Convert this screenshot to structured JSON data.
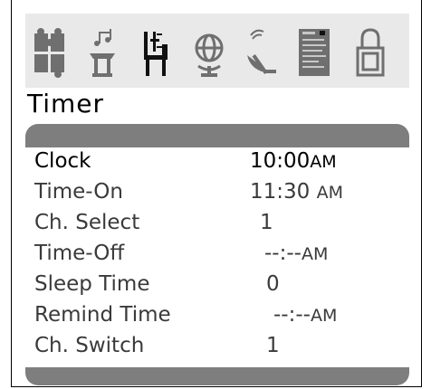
{
  "menu_icons": [
    {
      "name": "puzzle-icon"
    },
    {
      "name": "music-stage-icon"
    },
    {
      "name": "settings-chair-icon"
    },
    {
      "name": "globe-icon"
    },
    {
      "name": "satellite-dish-icon"
    },
    {
      "name": "document-page-icon"
    },
    {
      "name": "lock-icon"
    }
  ],
  "page": {
    "title": "Timer"
  },
  "rows": [
    {
      "label": "Clock",
      "value": "10:00",
      "ampm": "AM"
    },
    {
      "label": "Time-On",
      "value": "11:30",
      "ampm": "AM"
    },
    {
      "label": "Ch. Select",
      "value": "1",
      "ampm": ""
    },
    {
      "label": "Time-Off",
      "value": "--:--",
      "ampm": "AM"
    },
    {
      "label": "Sleep Time",
      "value": "0",
      "ampm": ""
    },
    {
      "label": "Remind Time",
      "value": "--:--",
      "ampm": "AM"
    },
    {
      "label": "Ch. Switch",
      "value": "1",
      "ampm": ""
    }
  ],
  "colors": {
    "icon_fill": "#6f6f6f",
    "bar": "#7e7e7e",
    "iconbar_bg": "#e9e9e9"
  }
}
